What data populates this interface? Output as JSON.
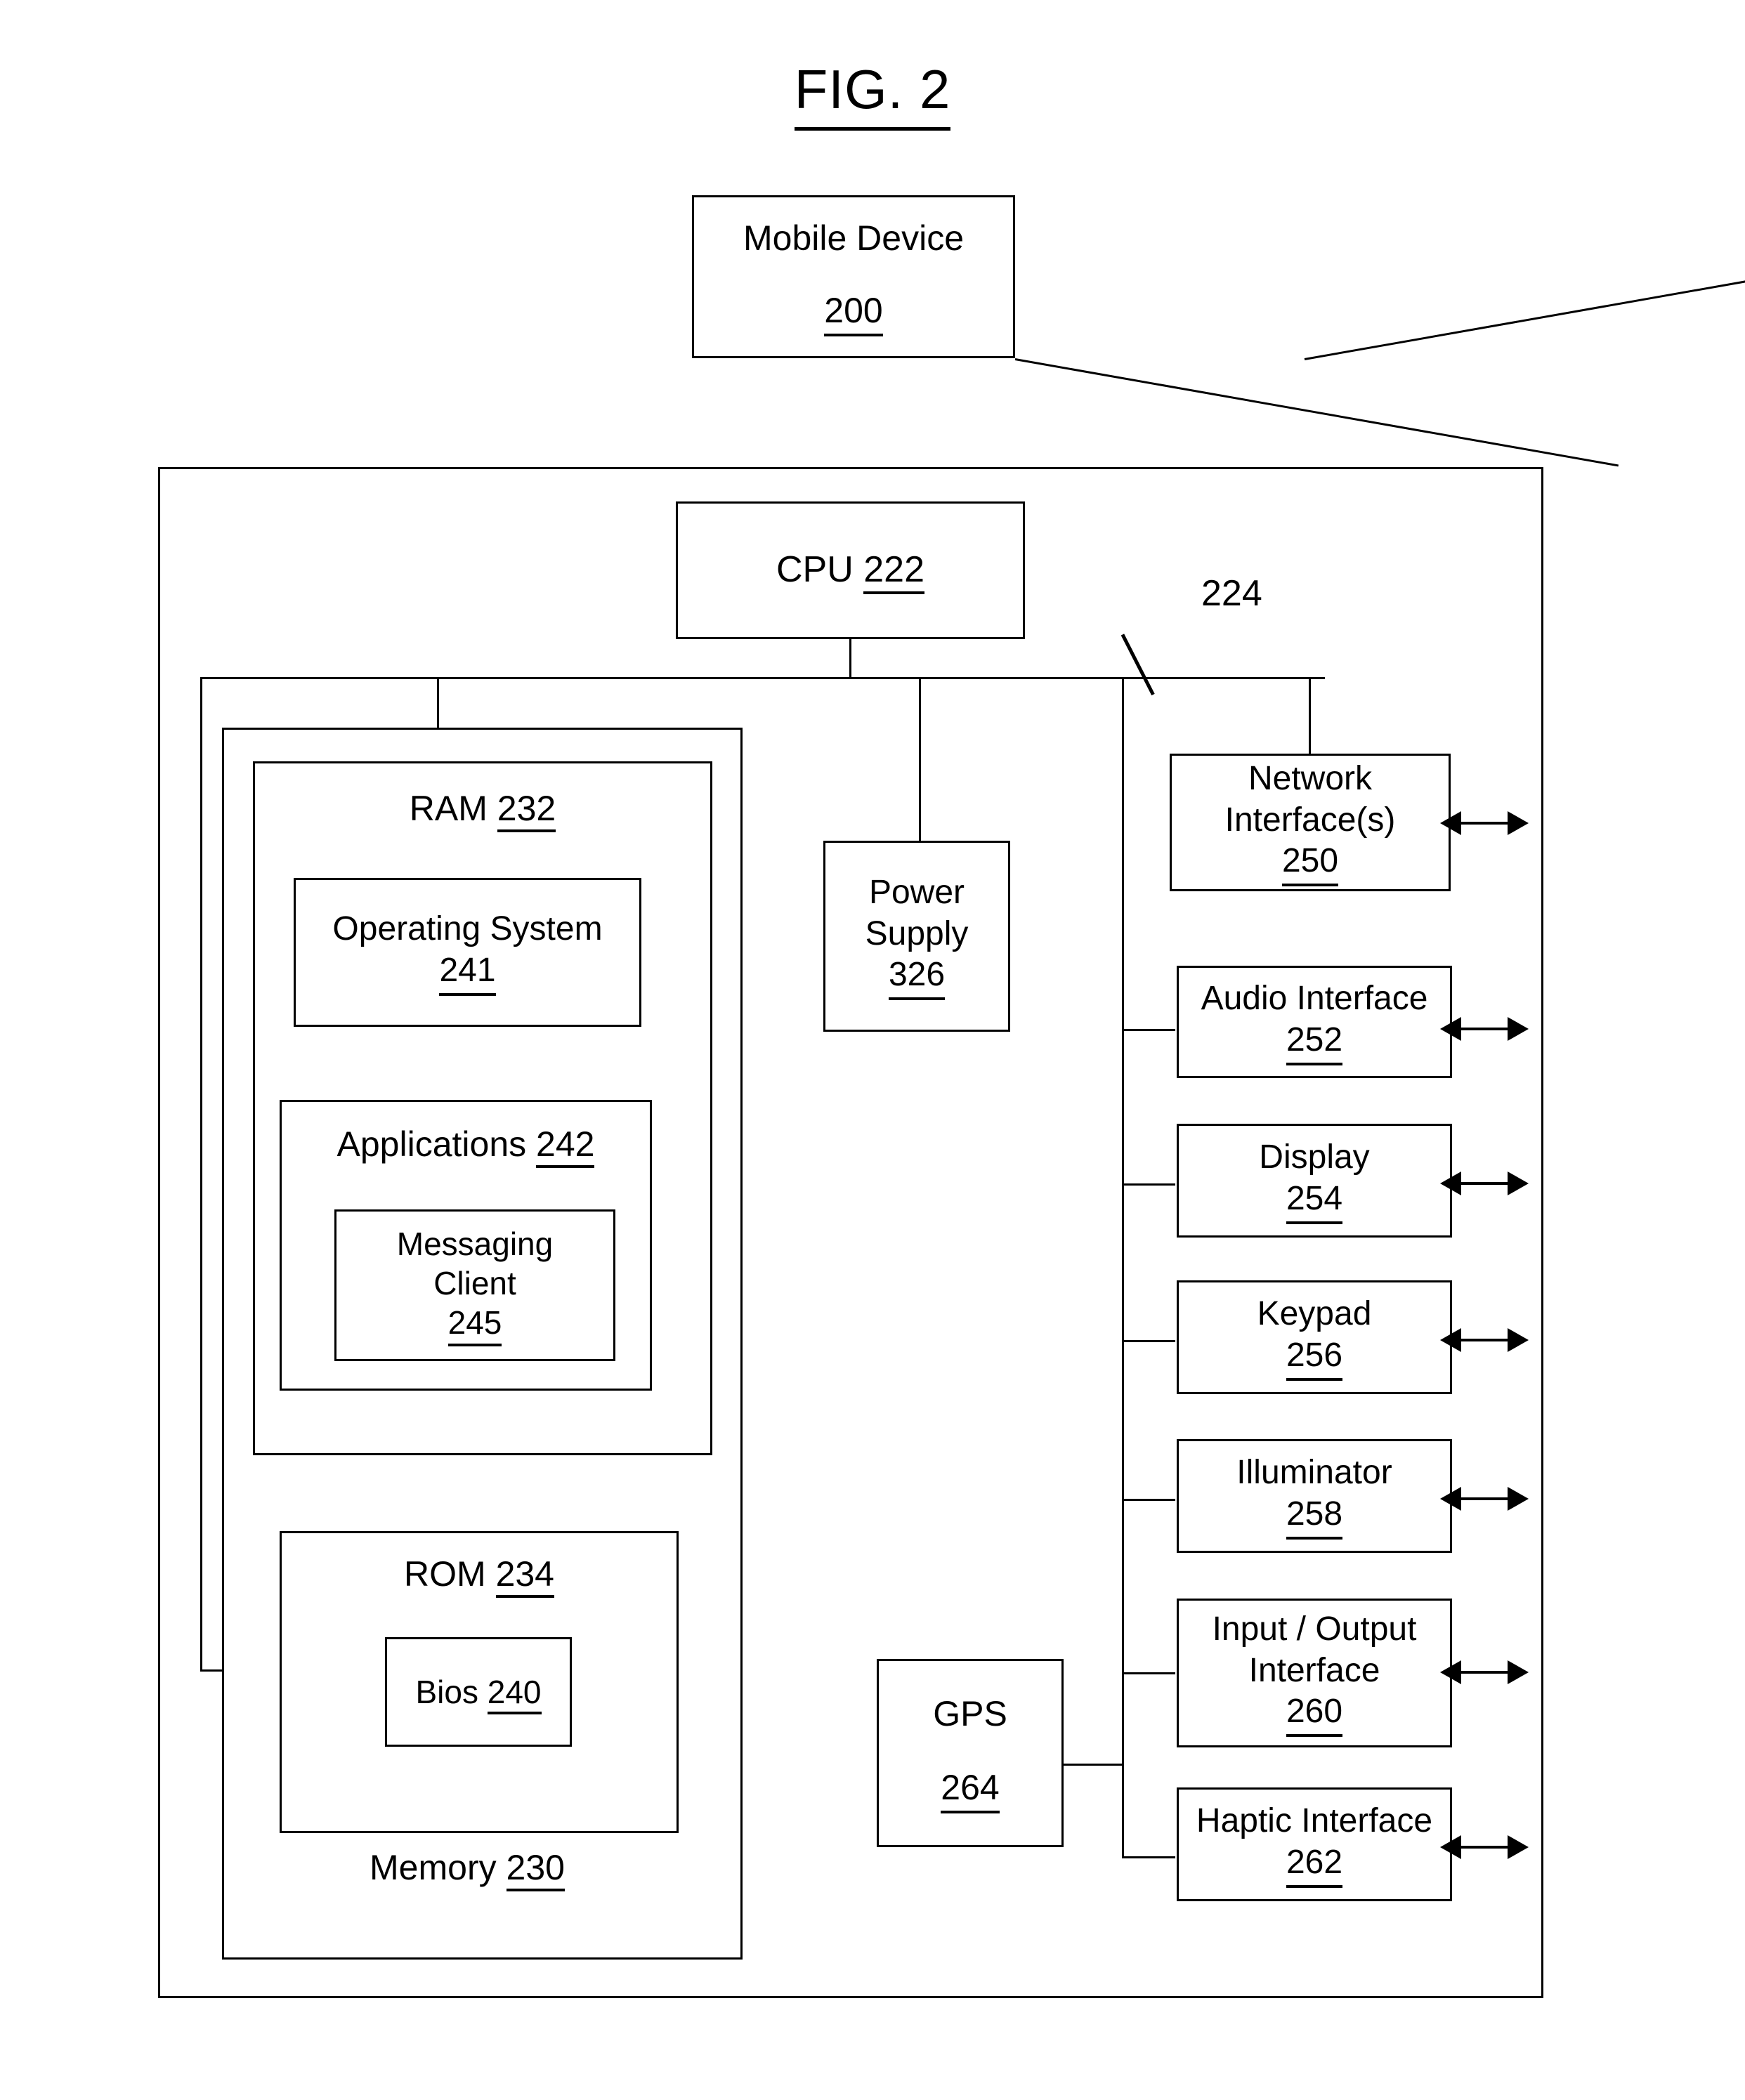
{
  "figure": {
    "title": "FIG. 2"
  },
  "top_block": {
    "label": "Mobile Device",
    "ref": "200"
  },
  "cpu": {
    "label": "CPU",
    "ref": "222"
  },
  "bus": {
    "ref": "224"
  },
  "memory": {
    "label": "Memory",
    "ref": "230",
    "ram": {
      "label": "RAM",
      "ref": "232",
      "operating_system": {
        "label": "Operating System",
        "ref": "241"
      },
      "applications": {
        "label": "Applications",
        "ref": "242",
        "messaging_client": {
          "line1": "Messaging",
          "line2": "Client",
          "ref": "245"
        }
      }
    },
    "rom": {
      "label": "ROM",
      "ref": "234",
      "bios": {
        "label": "Bios",
        "ref": "240"
      }
    }
  },
  "power_supply": {
    "line1": "Power",
    "line2": "Supply",
    "ref": "326"
  },
  "gps": {
    "label": "GPS",
    "ref": "264"
  },
  "peripherals": [
    {
      "line1": "Network",
      "line2": "Interface(s)",
      "ref": "250"
    },
    {
      "line1": "Audio Interface",
      "line2": "",
      "ref": "252"
    },
    {
      "line1": "Display",
      "line2": "",
      "ref": "254"
    },
    {
      "line1": "Keypad",
      "line2": "",
      "ref": "256"
    },
    {
      "line1": "Illuminator",
      "line2": "",
      "ref": "258"
    },
    {
      "line1": "Input / Output",
      "line2": "Interface",
      "ref": "260"
    },
    {
      "line1": "Haptic Interface",
      "line2": "",
      "ref": "262"
    }
  ],
  "colors": {
    "stroke": "#000000",
    "background": "#ffffff"
  }
}
